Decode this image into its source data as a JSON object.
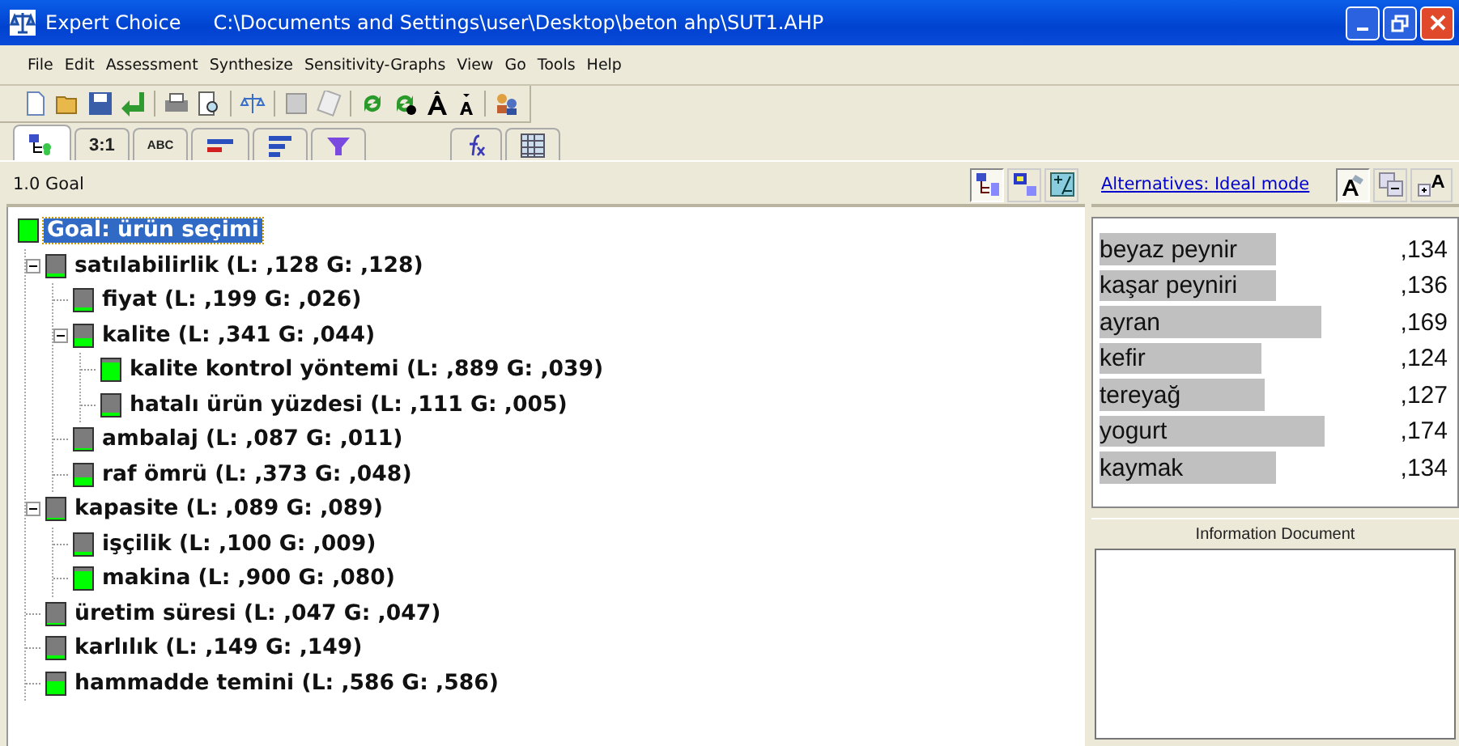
{
  "window": {
    "app": "Expert Choice",
    "path": "C:\\Documents and Settings\\user\\Desktop\\beton ahp\\SUT1.AHP"
  },
  "menu": [
    "File",
    "Edit",
    "Assessment",
    "Synthesize",
    "Sensitivity-Graphs",
    "View",
    "Go",
    "Tools",
    "Help"
  ],
  "tabs": [
    {
      "kind": "tree",
      "selected": true
    },
    {
      "kind": "text",
      "label": "3:1",
      "selected": false
    },
    {
      "kind": "small",
      "label": "ABC",
      "selected": false
    },
    {
      "kind": "bars",
      "selected": false
    },
    {
      "kind": "lines",
      "selected": false
    },
    {
      "kind": "funnel",
      "selected": false
    },
    {
      "kind": "fx",
      "selected": false
    },
    {
      "kind": "grid",
      "selected": false
    }
  ],
  "node_header": "1.0 Goal",
  "tree": {
    "goal": {
      "label": "Goal: ürün seçimi",
      "selected": true,
      "level": 1,
      "children": [
        {
          "label": "satılabilirlik (L: ,128 G: ,128)",
          "selected": false,
          "level": 0.128,
          "expanded": true,
          "children": [
            {
              "label": "fiyat (L: ,199 G: ,026)",
              "selected": false,
              "level": 0.199
            },
            {
              "label": "kalite (L: ,341 G: ,044)",
              "selected": false,
              "level": 0.341,
              "expanded": true,
              "children": [
                {
                  "label": "kalite kontrol yöntemi (L: ,889 G: ,039)",
                  "selected": false,
                  "level": 0.889
                },
                {
                  "label": "hatalı ürün yüzdesi (L: ,111 G: ,005)",
                  "selected": false,
                  "level": 0.111
                }
              ]
            },
            {
              "label": "ambalaj (L: ,087 G: ,011)",
              "selected": false,
              "level": 0.087
            },
            {
              "label": "raf ömrü (L: ,373 G: ,048)",
              "selected": false,
              "level": 0.373
            }
          ]
        },
        {
          "label": "kapasite (L: ,089 G: ,089)",
          "selected": false,
          "level": 0.089,
          "expanded": true,
          "children": [
            {
              "label": "işçilik (L: ,100 G: ,009)",
              "selected": false,
              "level": 0.1
            },
            {
              "label": "makina (L: ,900 G: ,080)",
              "selected": false,
              "level": 0.9
            }
          ]
        },
        {
          "label": "üretim süresi (L: ,047 G: ,047)",
          "selected": false,
          "level": 0.047
        },
        {
          "label": "karlılık (L: ,149 G: ,149)",
          "selected": false,
          "level": 0.149
        },
        {
          "label": "hammadde temini (L: ,586 G: ,586)",
          "selected": false,
          "level": 0.586
        }
      ]
    }
  },
  "alternatives_link": "Alternatives: Ideal mode",
  "alternatives": [
    {
      "name": "beyaz peynir",
      "value": ",134",
      "level": 0.5
    },
    {
      "name": "kaşar peyniri",
      "value": ",136",
      "level": 0.5
    },
    {
      "name": "ayran",
      "value": ",169",
      "level": 0.63
    },
    {
      "name": "kefir",
      "value": ",124",
      "level": 0.46
    },
    {
      "name": "tereyağ",
      "value": ",127",
      "level": 0.47
    },
    {
      "name": "yogurt",
      "value": ",174",
      "level": 0.64
    },
    {
      "name": "kaymak",
      "value": ",134",
      "level": 0.5
    }
  ],
  "info_label": "Information Document"
}
